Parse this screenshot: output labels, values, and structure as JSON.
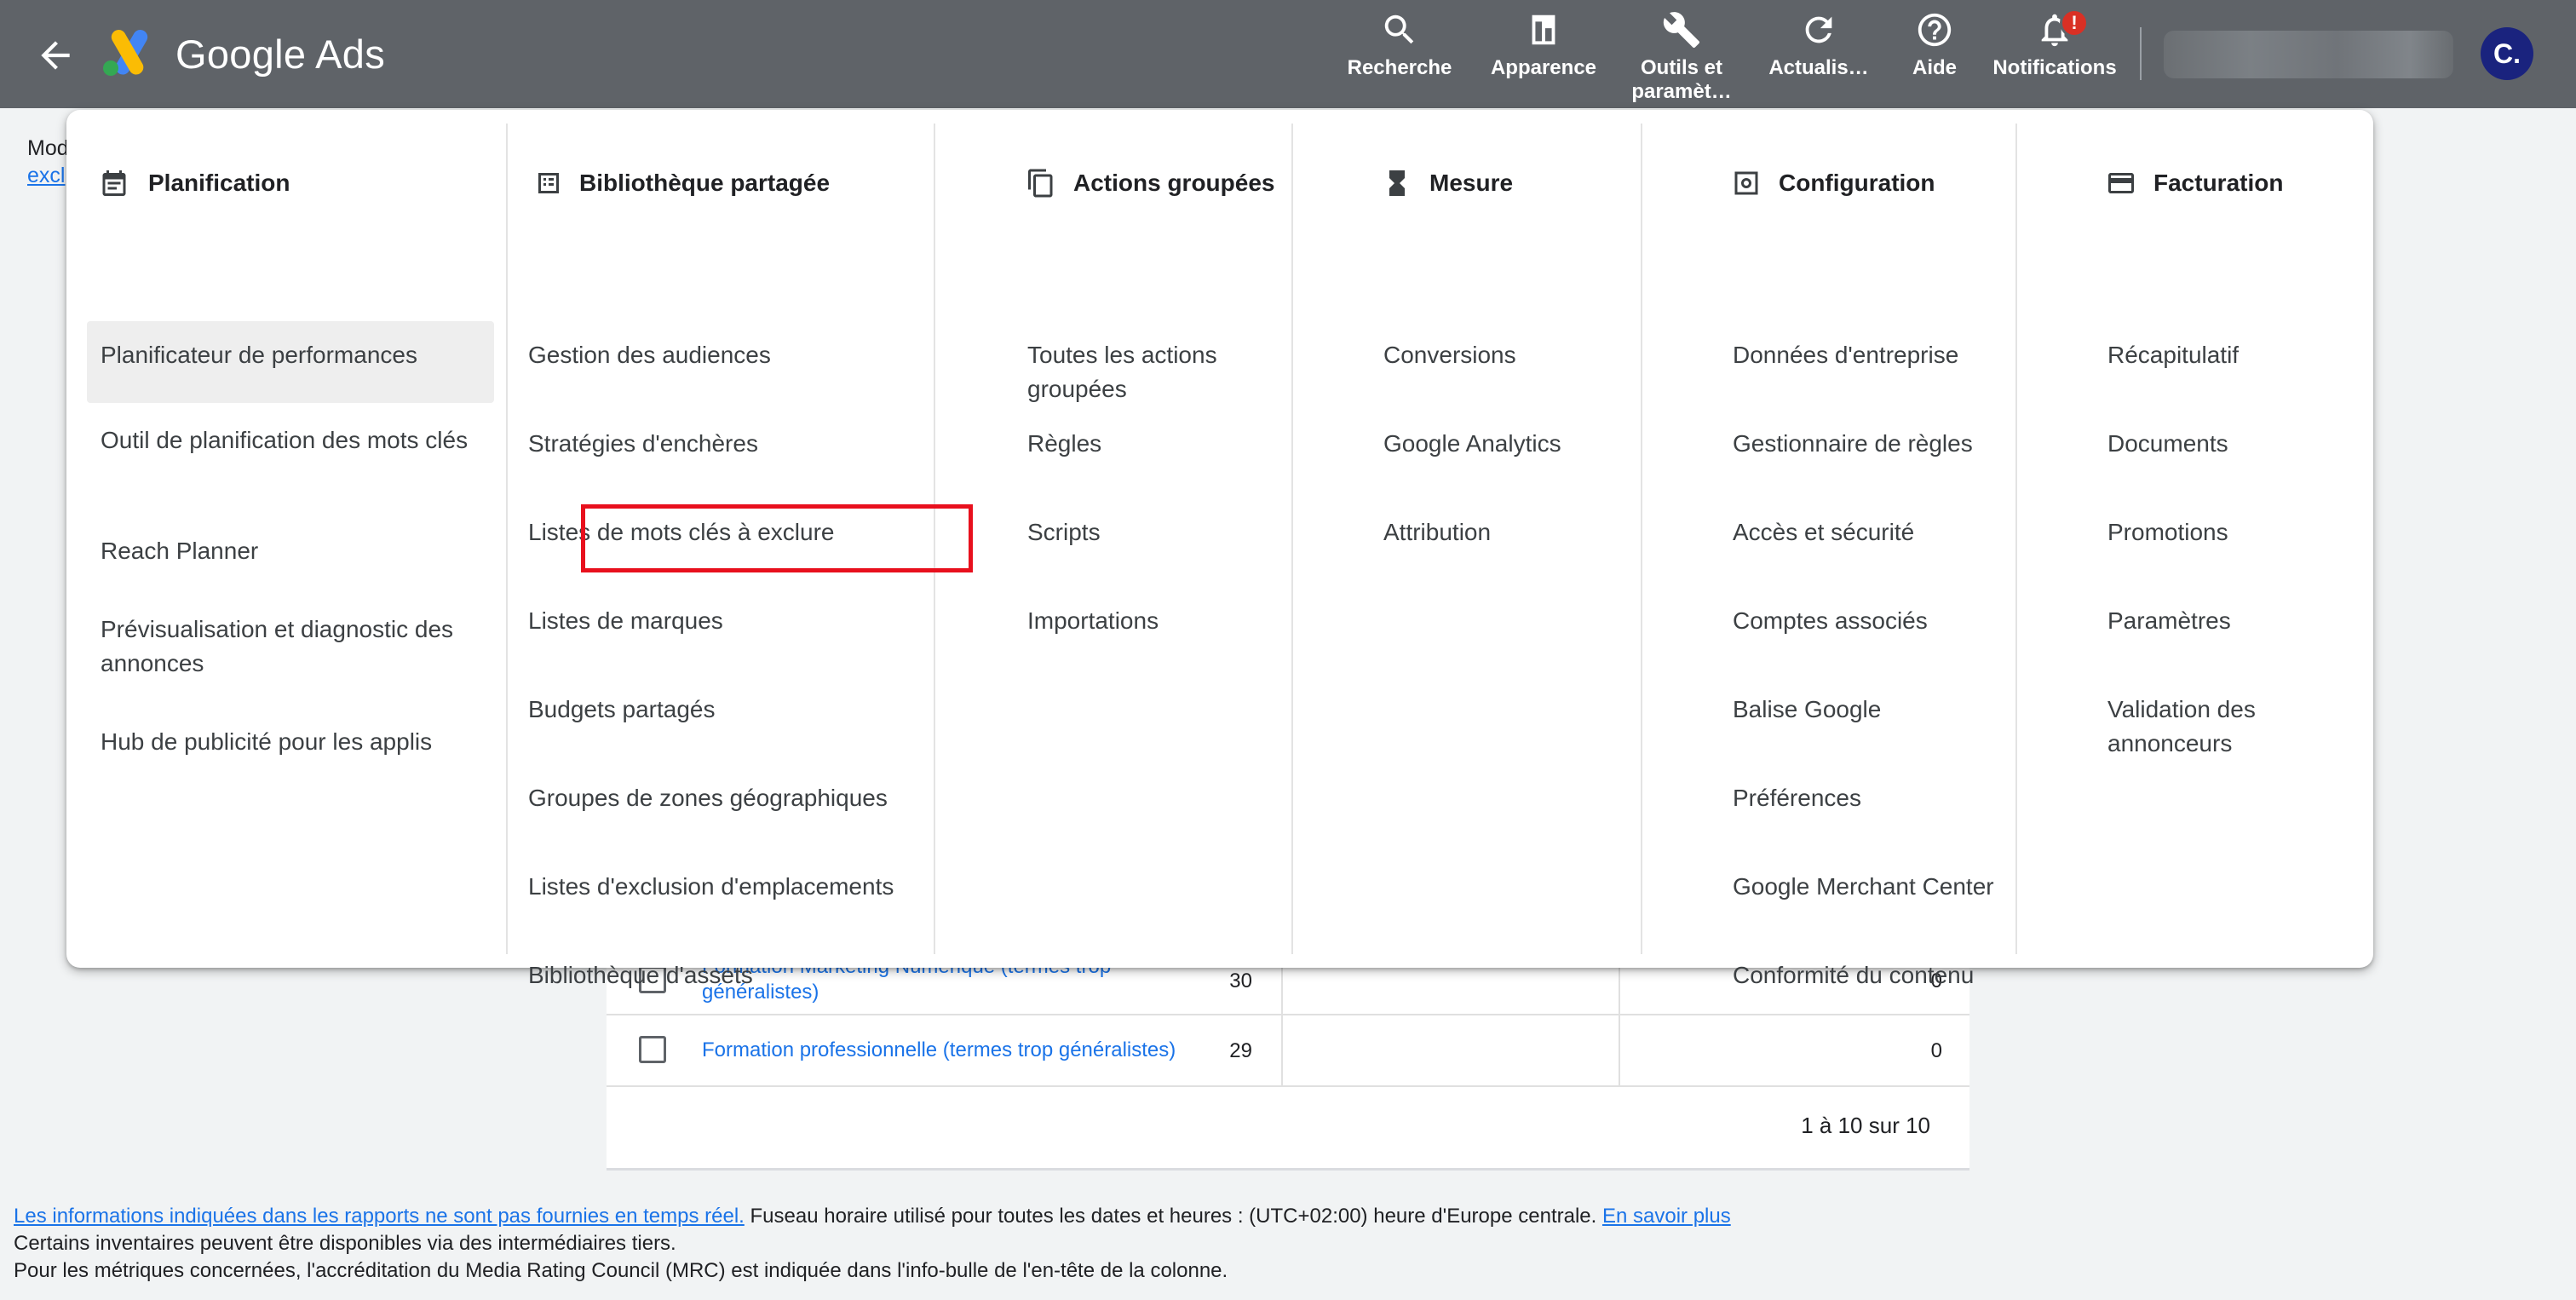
{
  "app": {
    "brand": "Google Ads"
  },
  "nav": {
    "search": "Recherche",
    "appearance": "Apparence",
    "tools_line1": "Outils et",
    "tools_line2": "paramèt…",
    "refresh": "Actualis…",
    "help": "Aide",
    "notifications": "Notifications",
    "notifications_badge": "!",
    "avatar_letter": "C."
  },
  "background": {
    "fragment_text": "Mod",
    "fragment_link": "excl",
    "rows": [
      {
        "keyword": "Formation Marketing Numérique (termes trop généralistes)",
        "col1": "30",
        "col2": "0"
      },
      {
        "keyword": "Formation professionnelle (termes trop généralistes)",
        "col1": "29",
        "col2": "0"
      }
    ],
    "pagination": "1 à 10 sur 10"
  },
  "footer": {
    "link1": "Les informations indiquées dans les rapports ne sont pas fournies en temps réel.",
    "text1": " Fuseau horaire utilisé pour toutes les dates et heures : (UTC+02:00) heure d'Europe centrale. ",
    "link2": "En savoir plus",
    "line2": "Certains inventaires peuvent être disponibles via des intermédiaires tiers.",
    "line3": "Pour les métriques concernées, l'accréditation du Media Rating Council (MRC) est indiquée dans l'info-bulle de l'en-tête de la colonne."
  },
  "menu": {
    "columns": [
      {
        "title": "Planification",
        "icon": "calendar-icon",
        "items": [
          "Planificateur de performances",
          "Outil de planification des mots clés",
          "Reach Planner",
          "Prévisualisation et diagnostic des annonces",
          "Hub de publicité pour les applis"
        ]
      },
      {
        "title": "Bibliothèque partagée",
        "icon": "library-icon",
        "items": [
          "Gestion des audiences",
          "Stratégies d'enchères",
          "Listes de mots clés à exclure",
          "Listes de marques",
          "Budgets partagés",
          "Groupes de zones géographiques",
          "Listes d'exclusion d'emplacements",
          "Bibliothèque d'assets"
        ]
      },
      {
        "title": "Actions groupées",
        "icon": "copy-icon",
        "items": [
          "Toutes les actions groupées",
          "Règles",
          "Scripts",
          "Importations"
        ]
      },
      {
        "title": "Mesure",
        "icon": "hourglass-icon",
        "items": [
          "Conversions",
          "Google Analytics",
          "Attribution"
        ]
      },
      {
        "title": "Configuration",
        "icon": "settings-icon",
        "items": [
          "Données d'entreprise",
          "Gestionnaire de règles",
          "Accès et sécurité",
          "Comptes associés",
          "Balise Google",
          "Préférences",
          "Google Merchant Center",
          "Conformité du contenu"
        ]
      },
      {
        "title": "Facturation",
        "icon": "credit-card-icon",
        "items": [
          "Récapitulatif",
          "Documents",
          "Promotions",
          "Paramètres",
          "Validation des annonceurs"
        ]
      }
    ]
  },
  "colors": {
    "topbar": "#5f6368",
    "link": "#1a73e8",
    "highlight": "#e8101d",
    "avatar": "#1a237e",
    "badge": "#d93025"
  }
}
